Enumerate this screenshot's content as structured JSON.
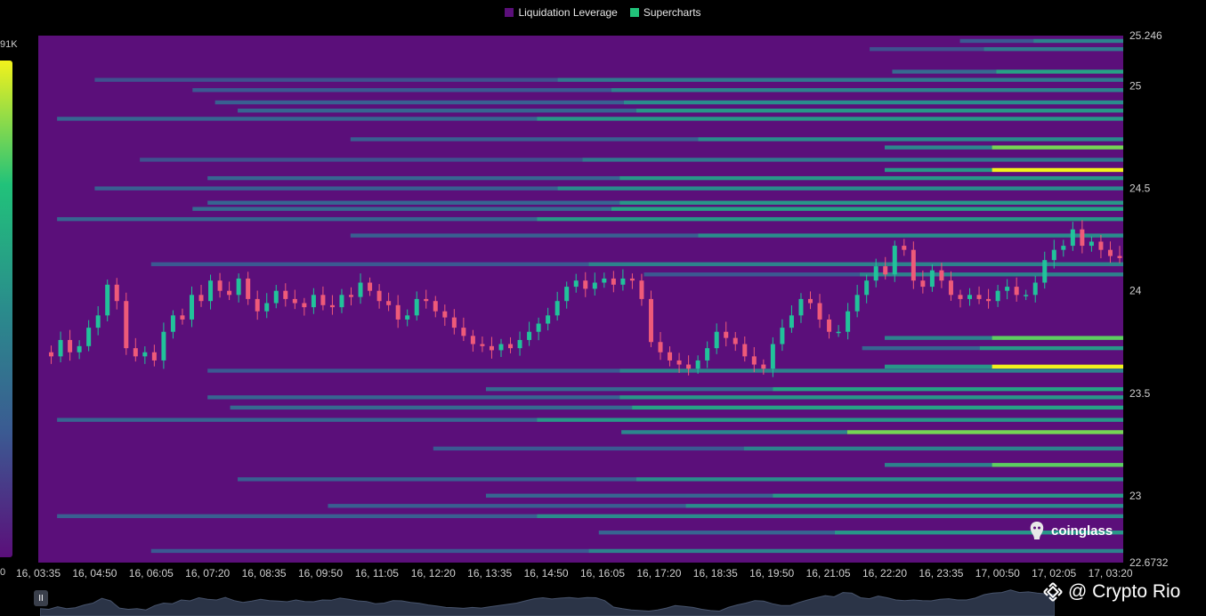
{
  "legend": [
    {
      "label": "Liquidation Leverage",
      "color": "#5b0f7a"
    },
    {
      "label": "Supercharts",
      "color": "#21c27a"
    }
  ],
  "scale": {
    "top_label": "91K",
    "bottom_label": "0"
  },
  "brand": {
    "name": "coinglass",
    "icon": "coinglass-logo-icon"
  },
  "watermark": {
    "text": "@ Crypto Rio",
    "icon": "binance-diamond-icon"
  },
  "navigator": {
    "pause_icon": "pause-icon",
    "pause_glyph": "II"
  },
  "chart_data": {
    "type": "heatmap",
    "title": "",
    "xlabel": "",
    "ylabel": "",
    "x_ticks": [
      "16, 03:35",
      "16, 04:50",
      "16, 06:05",
      "16, 07:20",
      "16, 08:35",
      "16, 09:50",
      "16, 11:05",
      "16, 12:20",
      "16, 13:35",
      "16, 14:50",
      "16, 16:05",
      "16, 17:20",
      "16, 18:35",
      "16, 19:50",
      "16, 21:05",
      "16, 22:20",
      "16, 23:35",
      "17, 00:50",
      "17, 02:05",
      "17, 03:20"
    ],
    "y_ticks": [
      {
        "value": 25.246,
        "label": "25.246"
      },
      {
        "value": 25,
        "label": "25"
      },
      {
        "value": 24.5,
        "label": "24.5"
      },
      {
        "value": 24,
        "label": "24"
      },
      {
        "value": 23.5,
        "label": "23.5"
      },
      {
        "value": 23,
        "label": "23"
      },
      {
        "value": 22.6732,
        "label": "22.6732"
      }
    ],
    "ylim": [
      22.6732,
      25.246
    ],
    "color_scale": {
      "min": 0,
      "max": 91,
      "unit": "K",
      "colors": [
        "#5b0f7a",
        "#3b5a92",
        "#2a8c8c",
        "#21c27a",
        "#f2f21c"
      ]
    },
    "background_color": "#5b0f7a",
    "candle_colors": {
      "up": "#21c29a",
      "down": "#ee5a79"
    },
    "liquidation_levels": [
      {
        "price": 25.22,
        "start": "17, 00:00",
        "intensity": 0.45
      },
      {
        "price": 25.18,
        "start": "16, 22:00",
        "intensity": 0.4
      },
      {
        "price": 25.07,
        "start": "16, 22:30",
        "intensity": 0.6
      },
      {
        "price": 25.03,
        "start": "16, 04:50",
        "intensity": 0.4
      },
      {
        "price": 24.98,
        "start": "16, 07:00",
        "intensity": 0.45
      },
      {
        "price": 24.92,
        "start": "16, 07:30",
        "intensity": 0.5
      },
      {
        "price": 24.88,
        "start": "16, 08:00",
        "intensity": 0.55
      },
      {
        "price": 24.84,
        "start": "16, 04:00",
        "intensity": 0.55
      },
      {
        "price": 24.74,
        "start": "16, 10:30",
        "intensity": 0.5
      },
      {
        "price": 24.7,
        "start": "16, 22:20",
        "intensity": 0.85
      },
      {
        "price": 24.64,
        "start": "16, 05:50",
        "intensity": 0.4
      },
      {
        "price": 24.59,
        "start": "16, 22:20",
        "intensity": 1.0
      },
      {
        "price": 24.55,
        "start": "16, 07:20",
        "intensity": 0.55
      },
      {
        "price": 24.5,
        "start": "16, 04:50",
        "intensity": 0.5
      },
      {
        "price": 24.43,
        "start": "16, 07:20",
        "intensity": 0.55
      },
      {
        "price": 24.4,
        "start": "16, 07:00",
        "intensity": 0.6
      },
      {
        "price": 24.35,
        "start": "16, 04:00",
        "intensity": 0.55
      },
      {
        "price": 24.27,
        "start": "16, 10:30",
        "intensity": 0.5
      },
      {
        "price": 24.13,
        "start": "16, 06:05",
        "intensity": 0.45
      },
      {
        "price": 24.08,
        "start": "16, 17:00",
        "intensity": 0.45
      },
      {
        "price": 23.77,
        "start": "16, 22:20",
        "intensity": 0.82
      },
      {
        "price": 23.72,
        "start": "16, 21:50",
        "intensity": 0.55
      },
      {
        "price": 23.63,
        "start": "16, 22:20",
        "intensity": 1.0
      },
      {
        "price": 23.61,
        "start": "16, 07:20",
        "intensity": 0.45
      },
      {
        "price": 23.52,
        "start": "16, 13:30",
        "intensity": 0.6
      },
      {
        "price": 23.48,
        "start": "16, 07:20",
        "intensity": 0.55
      },
      {
        "price": 23.43,
        "start": "16, 07:50",
        "intensity": 0.6
      },
      {
        "price": 23.37,
        "start": "16, 04:00",
        "intensity": 0.55
      },
      {
        "price": 23.31,
        "start": "16, 16:30",
        "intensity": 0.85
      },
      {
        "price": 23.23,
        "start": "16, 12:20",
        "intensity": 0.45
      },
      {
        "price": 23.15,
        "start": "16, 22:20",
        "intensity": 0.82
      },
      {
        "price": 23.08,
        "start": "16, 08:00",
        "intensity": 0.5
      },
      {
        "price": 23.0,
        "start": "16, 13:30",
        "intensity": 0.55
      },
      {
        "price": 22.95,
        "start": "16, 10:00",
        "intensity": 0.5
      },
      {
        "price": 22.9,
        "start": "16, 04:00",
        "intensity": 0.5
      },
      {
        "price": 22.82,
        "start": "16, 16:00",
        "intensity": 0.55
      },
      {
        "price": 22.73,
        "start": "16, 06:05",
        "intensity": 0.45
      }
    ],
    "price_series": [
      23.7,
      23.68,
      23.76,
      23.7,
      23.73,
      23.82,
      23.88,
      24.03,
      23.95,
      23.72,
      23.68,
      23.7,
      23.66,
      23.8,
      23.88,
      23.86,
      23.98,
      23.95,
      24.05,
      24.0,
      23.98,
      24.06,
      23.96,
      23.9,
      23.94,
      24.0,
      23.96,
      23.94,
      23.92,
      23.98,
      23.93,
      23.92,
      23.98,
      23.97,
      24.04,
      24.0,
      23.95,
      23.93,
      23.86,
      23.88,
      23.96,
      23.95,
      23.9,
      23.87,
      23.82,
      23.78,
      23.74,
      23.73,
      23.71,
      23.74,
      23.72,
      23.76,
      23.8,
      23.84,
      23.88,
      23.95,
      24.02,
      24.05,
      24.01,
      24.04,
      24.06,
      24.03,
      24.06,
      24.05,
      23.96,
      23.75,
      23.7,
      23.66,
      23.64,
      23.62,
      23.66,
      23.72,
      23.8,
      23.77,
      23.74,
      23.68,
      23.64,
      23.62,
      23.74,
      23.82,
      23.88,
      23.96,
      23.94,
      23.86,
      23.8,
      23.8,
      23.9,
      23.98,
      24.05,
      24.12,
      24.08,
      24.22,
      24.2,
      24.05,
      24.02,
      24.1,
      24.05,
      23.98,
      23.96,
      23.98,
      23.96,
      23.95,
      24.0,
      24.02,
      23.98,
      23.98,
      24.04,
      24.15,
      24.2,
      24.22,
      24.3,
      24.22,
      24.24,
      24.2,
      24.17,
      24.16
    ]
  }
}
